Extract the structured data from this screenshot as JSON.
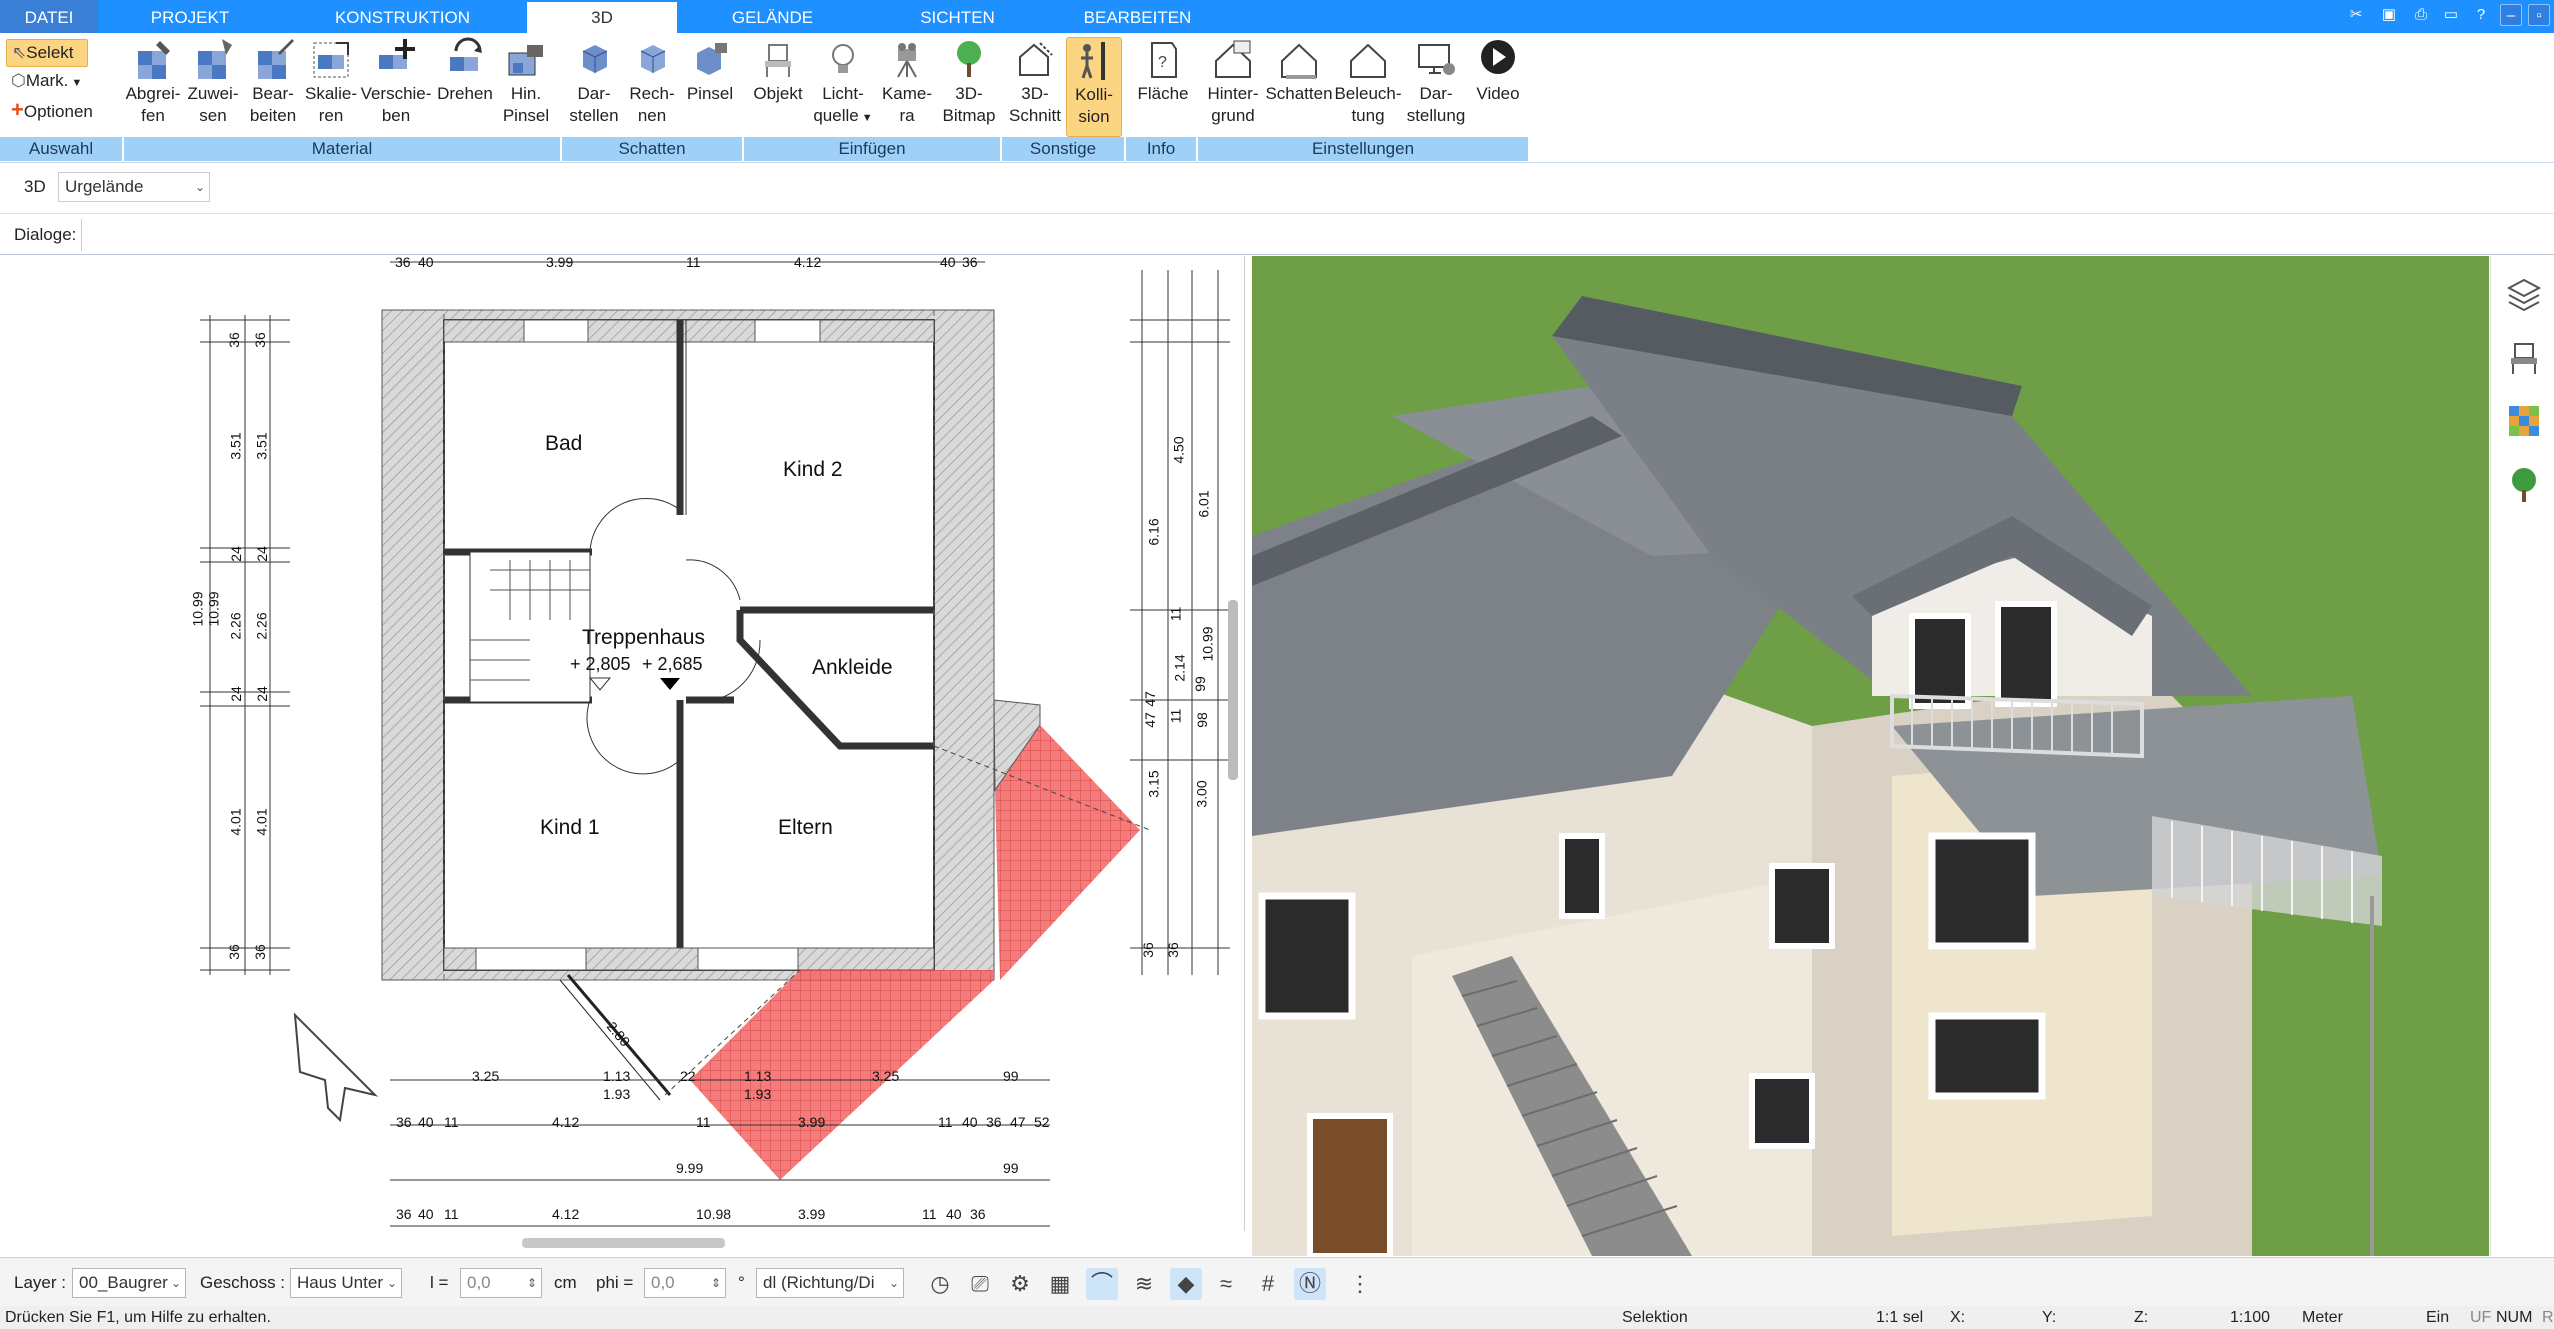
{
  "menu": {
    "tabs": [
      "DATEI",
      "PROJEKT",
      "KONSTRUKTION",
      "3D",
      "GELÄNDE",
      "SICHTEN",
      "BEARBEITEN"
    ],
    "active": "3D"
  },
  "ribbon": {
    "auswahl": {
      "select": "Selekt",
      "mark": "Mark.",
      "options": "Optionen",
      "label": "Auswahl"
    },
    "material": {
      "label": "Material",
      "buttons": [
        {
          "l1": "Abgrei-",
          "l2": "fen"
        },
        {
          "l1": "Zuwei-",
          "l2": "sen"
        },
        {
          "l1": "Bear-",
          "l2": "beiten"
        },
        {
          "l1": "Skalie-",
          "l2": "ren"
        },
        {
          "l1": "Verschie-",
          "l2": "ben"
        },
        {
          "l1": "Drehen",
          "l2": ""
        },
        {
          "l1": "Hin.",
          "l2": "Pinsel"
        }
      ]
    },
    "schatten": {
      "label": "Schatten",
      "buttons": [
        {
          "l1": "Dar-",
          "l2": "stellen"
        },
        {
          "l1": "Rech-",
          "l2": "nen"
        },
        {
          "l1": "Pinsel",
          "l2": ""
        }
      ]
    },
    "einfuegen": {
      "label": "Einfügen",
      "buttons": [
        {
          "l1": "Objekt",
          "l2": ""
        },
        {
          "l1": "Licht-",
          "l2": "quelle"
        },
        {
          "l1": "Kame-",
          "l2": "ra"
        },
        {
          "l1": "3D-",
          "l2": "Bitmap"
        }
      ]
    },
    "sonstige": {
      "label": "Sonstige",
      "buttons": [
        {
          "l1": "3D-",
          "l2": "Schnitt"
        },
        {
          "l1": "Kolli-",
          "l2": "sion"
        }
      ]
    },
    "info": {
      "label": "Info",
      "buttons": [
        {
          "l1": "Fläche",
          "l2": ""
        }
      ]
    },
    "einstellungen": {
      "label": "Einstellungen",
      "buttons": [
        {
          "l1": "Hinter-",
          "l2": "grund"
        },
        {
          "l1": "Schatten",
          "l2": ""
        },
        {
          "l1": "Beleuch-",
          "l2": "tung"
        },
        {
          "l1": "Dar-",
          "l2": "stellung"
        },
        {
          "l1": "Video",
          "l2": ""
        }
      ]
    }
  },
  "toolbar": {
    "mode": "3D",
    "terrain_value": "Urgelände"
  },
  "dialogs": {
    "label": "Dialoge:"
  },
  "plan": {
    "rooms": [
      "Bad",
      "Kind 2",
      "Treppenhaus",
      "Ankleide",
      "Kind 1",
      "Eltern"
    ],
    "levels": [
      "+ 2,805",
      "+ 2,685"
    ],
    "top_dims": [
      "36",
      "40",
      "3.99",
      "11",
      "4.12",
      "40",
      "36"
    ],
    "left_outer": [
      "10.99",
      "10.99"
    ],
    "left_inner": [
      "36",
      "3.51",
      "24",
      "2.26",
      "24",
      "4.01",
      "36"
    ],
    "left_inner2": [
      "36",
      "3.51",
      "24",
      "2.26",
      "24",
      "4.01",
      "36"
    ],
    "right_dims": [
      "6.16",
      "4.50",
      "6.01",
      "11",
      "10.99",
      "2.14",
      "99",
      "47",
      "47",
      "98",
      "11",
      "3.15",
      "3.00",
      "36",
      "36"
    ],
    "bottom_row1": [
      "3.25",
      "1.13",
      "1.93",
      "22",
      "1.13",
      "1.93",
      "3.25",
      "99"
    ],
    "bottom_row2": [
      "36",
      "40",
      "11",
      "4.12",
      "11",
      "3.99",
      "11",
      "40",
      "36",
      "47",
      "52"
    ],
    "bottom_row3": [
      "9.99",
      "99"
    ],
    "bottom_row4": [
      "36",
      "40",
      "11",
      "4.12",
      "10.98",
      "3.99",
      "11",
      "40",
      "36"
    ],
    "diag": "2.80"
  },
  "bottom": {
    "layer_label": "Layer :",
    "layer_value": "00_Baugrer",
    "geschoss_label": "Geschoss :",
    "geschoss_value": "Haus Unter",
    "l_label": "l =",
    "l_value": "0,0",
    "l_unit": "cm",
    "phi_label": "phi =",
    "phi_value": "0,0",
    "phi_unit": "°",
    "dl_value": "dl (Richtung/Di"
  },
  "status": {
    "help": "Drücken Sie F1, um Hilfe zu erhalten.",
    "mode": "Selektion",
    "sel": "1:1 sel",
    "x": "X:",
    "y": "Y:",
    "z": "Z:",
    "scale": "1:100",
    "unit": "Meter",
    "ein": "Ein",
    "uf": "UF",
    "num": "NUM",
    "rf": "RF"
  },
  "colors": {
    "accent": "#1e90ff",
    "group": "#9fd0f7",
    "highlight": "#fcd582",
    "collision": "#f25c5c",
    "grass": "#73a94d"
  }
}
